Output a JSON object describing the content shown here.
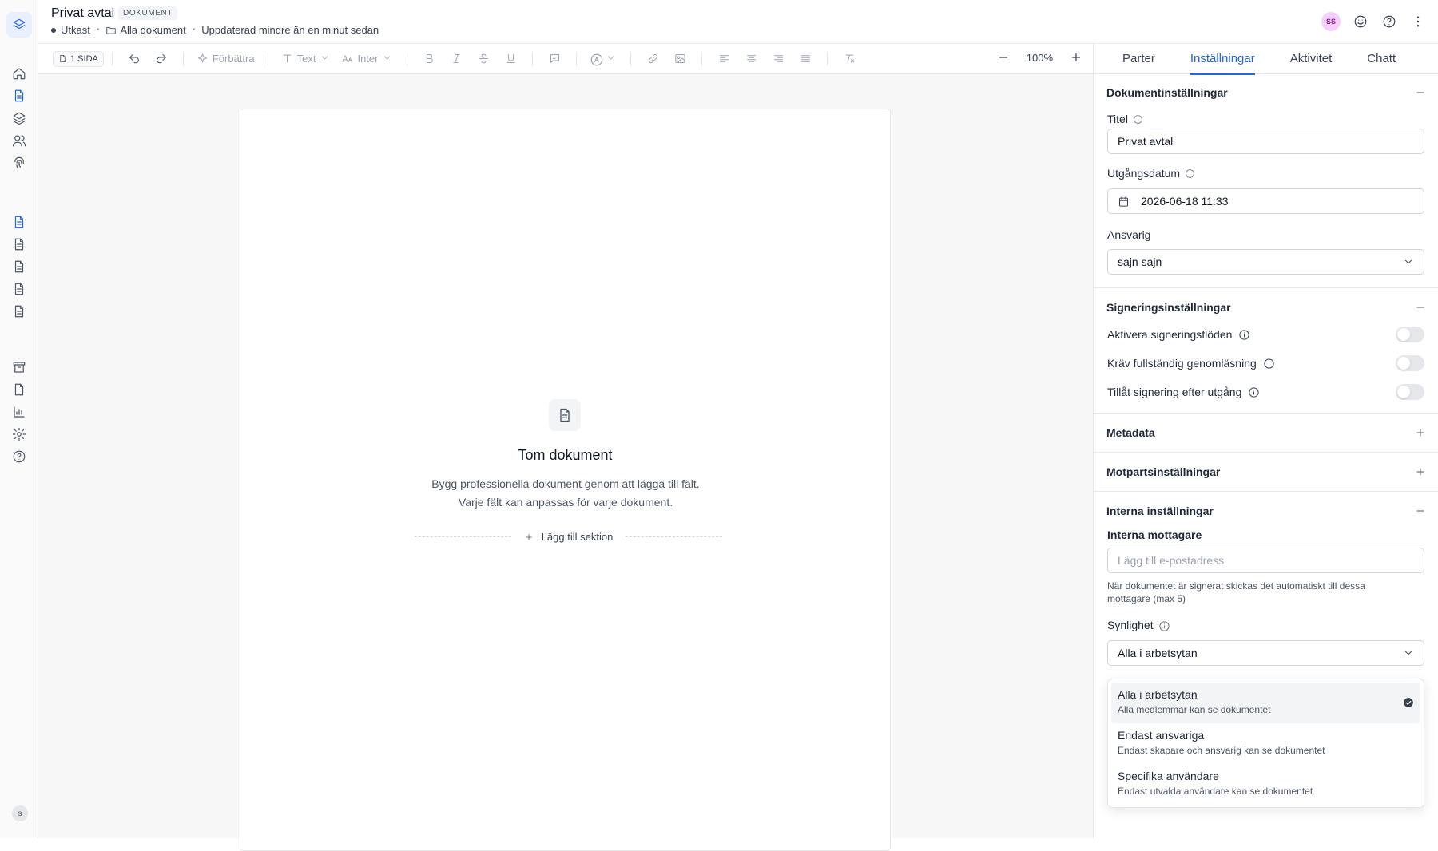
{
  "header": {
    "title": "Privat avtal",
    "badge": "DOKUMENT",
    "status": "Utkast",
    "folder": "Alla dokument",
    "updated": "Uppdaterad mindre än en minut sedan",
    "avatar_initials": "SS"
  },
  "toolbar": {
    "pages": "1 SIDA",
    "improve": "Förbättra",
    "text_style": "Text",
    "font": "Inter",
    "zoom": "100%"
  },
  "canvas": {
    "empty_title": "Tom dokument",
    "empty_desc": "Bygg professionella dokument genom att lägga till fält. Varje fält kan anpassas för varje dokument.",
    "add_section": "Lägg till sektion"
  },
  "panel": {
    "tabs": [
      "Parter",
      "Inställningar",
      "Aktivitet",
      "Chatt"
    ],
    "active_tab": "Inställningar",
    "doc_settings": {
      "heading": "Dokumentinställningar",
      "title_label": "Titel",
      "title_value": "Privat avtal",
      "expiry_label": "Utgångsdatum",
      "expiry_value": "2026-06-18 11:33",
      "owner_label": "Ansvarig",
      "owner_value": "sajn sajn"
    },
    "signing": {
      "heading": "Signeringsinställningar",
      "items": [
        {
          "label": "Aktivera signeringsflöden",
          "on": false
        },
        {
          "label": "Kräv fullständig genomläsning",
          "on": false
        },
        {
          "label": "Tillåt signering efter utgång",
          "on": false
        }
      ]
    },
    "metadata": {
      "heading": "Metadata"
    },
    "counterparty": {
      "heading": "Motpartsinställningar"
    },
    "internal": {
      "heading": "Interna inställningar",
      "recipients_label": "Interna mottagare",
      "recipients_placeholder": "Lägg till e-postadress",
      "recipients_help": "När dokumentet är signerat skickas det automatiskt till dessa mottagare (max 5)",
      "visibility_label": "Synlighet",
      "visibility_value": "Alla i arbetsytan"
    }
  },
  "visibility_options": [
    {
      "title": "Alla i arbetsytan",
      "desc": "Alla medlemmar kan se dokumentet",
      "selected": true
    },
    {
      "title": "Endast ansvariga",
      "desc": "Endast skapare och ansvarig kan se dokumentet",
      "selected": false
    },
    {
      "title": "Specifika användare",
      "desc": "Endast utvalda användare kan se dokumentet",
      "selected": false
    }
  ],
  "user_initial": "s",
  "colors": {
    "accent": "#2563eb",
    "avatar_bg": "#f5d0fe"
  }
}
